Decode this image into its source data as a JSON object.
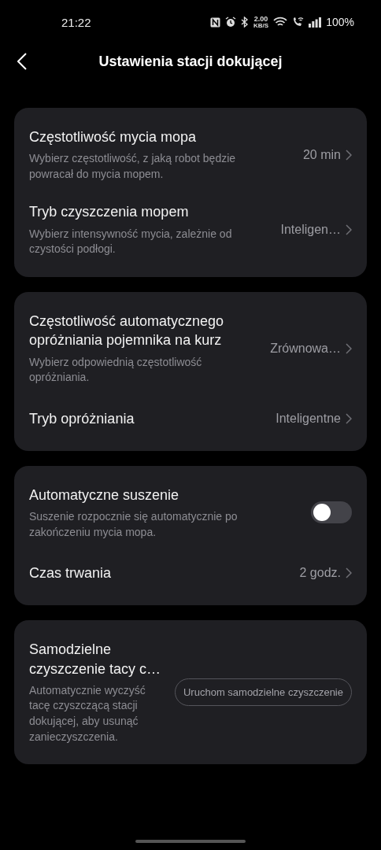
{
  "status_bar": {
    "time": "21:22",
    "speed": "2.00",
    "speed_unit": "KB/S",
    "battery": "100%"
  },
  "header": {
    "title": "Ustawienia stacji dokującej"
  },
  "cards": [
    {
      "rows": [
        {
          "kind": "value",
          "title": "Częstotliwość mycia mopa",
          "description": "Wybierz częstotliwość, z jaką robot będzie powracał do mycia mopem.",
          "value": "20 min"
        },
        {
          "kind": "value",
          "title": "Tryb czyszczenia mopem",
          "description": "Wybierz intensywność mycia, zależnie od czystości podłogi.",
          "value": "Inteligen…"
        }
      ]
    },
    {
      "rows": [
        {
          "kind": "value",
          "title": "Częstotliwość automatycznego opróżniania pojemnika na kurz",
          "description": "Wybierz odpowiednią częstotliwość opróżniania.",
          "value": "Zrównowa…"
        },
        {
          "kind": "value",
          "title": "Tryb opróżniania",
          "value": "Inteligentne"
        }
      ]
    },
    {
      "rows": [
        {
          "kind": "toggle",
          "title": "Automatyczne suszenie",
          "description": "Suszenie rozpocznie się automatycznie po zakończeniu mycia mopa.",
          "on": false
        },
        {
          "kind": "value",
          "title": "Czas trwania",
          "value": "2 godz."
        }
      ]
    },
    {
      "rows": [
        {
          "kind": "action",
          "title": "Samodzielne czyszczenie tacy c…",
          "description": "Automatycznie wyczyść tacę czyszczącą stacji dokującej, aby usunąć zanieczyszczenia.",
          "action": "Uruchom samodzielne czyszczenie"
        }
      ]
    }
  ]
}
